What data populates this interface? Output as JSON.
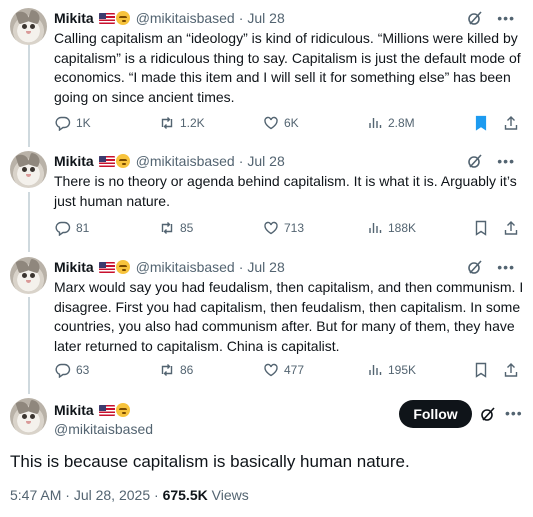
{
  "author": {
    "name": "Mikita",
    "handle": "@mikitaisbased"
  },
  "tweets": [
    {
      "date": "Jul 28",
      "text": "Calling capitalism an “ideology” is kind of ridiculous. “Millions were killed by capitalism” is a ridiculous thing to say. Capitalism is just the default mode of economics. “I made this item and I will sell it for something else” has been going on since ancient times.",
      "replies": "1K",
      "reposts": "1.2K",
      "likes": "6K",
      "views": "2.8M",
      "bookmarked": true
    },
    {
      "date": "Jul 28",
      "text": "There is no theory or agenda behind capitalism. It is what it is. Arguably it’s just human nature.",
      "replies": "81",
      "reposts": "85",
      "likes": "713",
      "views": "188K",
      "bookmarked": false
    },
    {
      "date": "Jul 28",
      "text": "Marx would say you had feudalism, then capitalism, and then communism. I disagree. First you had capitalism, then feudalism, then capitalism. In some countries, you also had communism after. But for many of them, they have later returned to capitalism. China is capitalist.",
      "replies": "63",
      "reposts": "86",
      "likes": "477",
      "views": "195K",
      "bookmarked": false
    }
  ],
  "focused": {
    "follow_label": "Follow",
    "text": "This is because capitalism is basically human nature.",
    "time": "5:47 AM",
    "date": "Jul 28, 2025",
    "views_count": "675.5K",
    "views_label": "Views"
  },
  "colors": {
    "text": "#0f1419",
    "secondary": "#536471",
    "accent": "#1d9bf0",
    "thread_line": "#cfd9de"
  },
  "icons": [
    "grok-icon",
    "more-icon",
    "reply-icon",
    "repost-icon",
    "like-icon",
    "views-icon",
    "bookmark-icon",
    "share-icon",
    "flag-us-icon",
    "saluting-face-icon"
  ]
}
